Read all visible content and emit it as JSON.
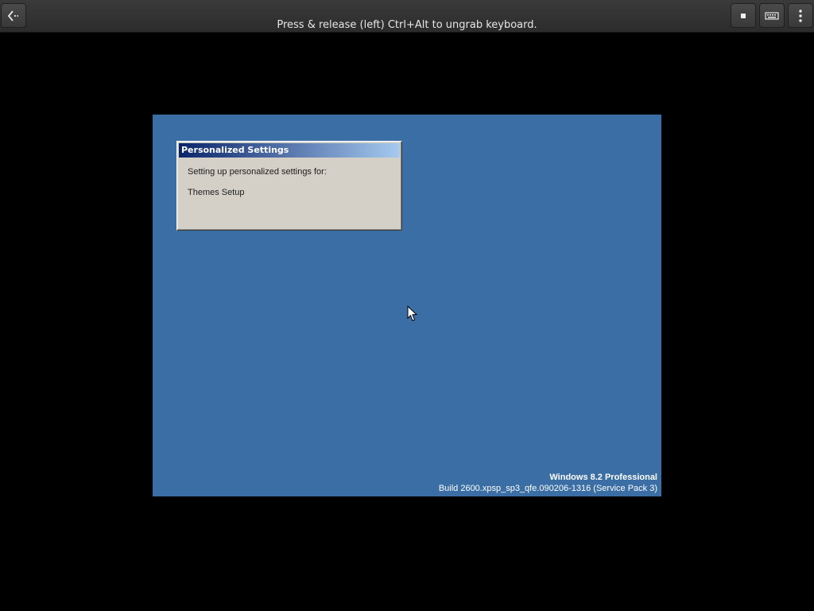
{
  "viewer": {
    "grab_message": "Press & release (left) Ctrl+Alt to ungrab keyboard.",
    "buttons": {
      "back": "back-arrow-icon",
      "stop": "stop-icon",
      "keyboard": "keyboard-icon",
      "menu": "vertical-dots-menu-icon"
    }
  },
  "guest": {
    "desktop_color": "#3a6ea5",
    "dialog": {
      "title": "Personalized Settings",
      "message": "Setting up personalized settings for:",
      "item": "Themes Setup"
    },
    "branding": {
      "product": "Windows 8.2 Professional",
      "build": "Build 2600.xpsp_sp3_qfe.090206-1316 (Service Pack 3)"
    }
  }
}
